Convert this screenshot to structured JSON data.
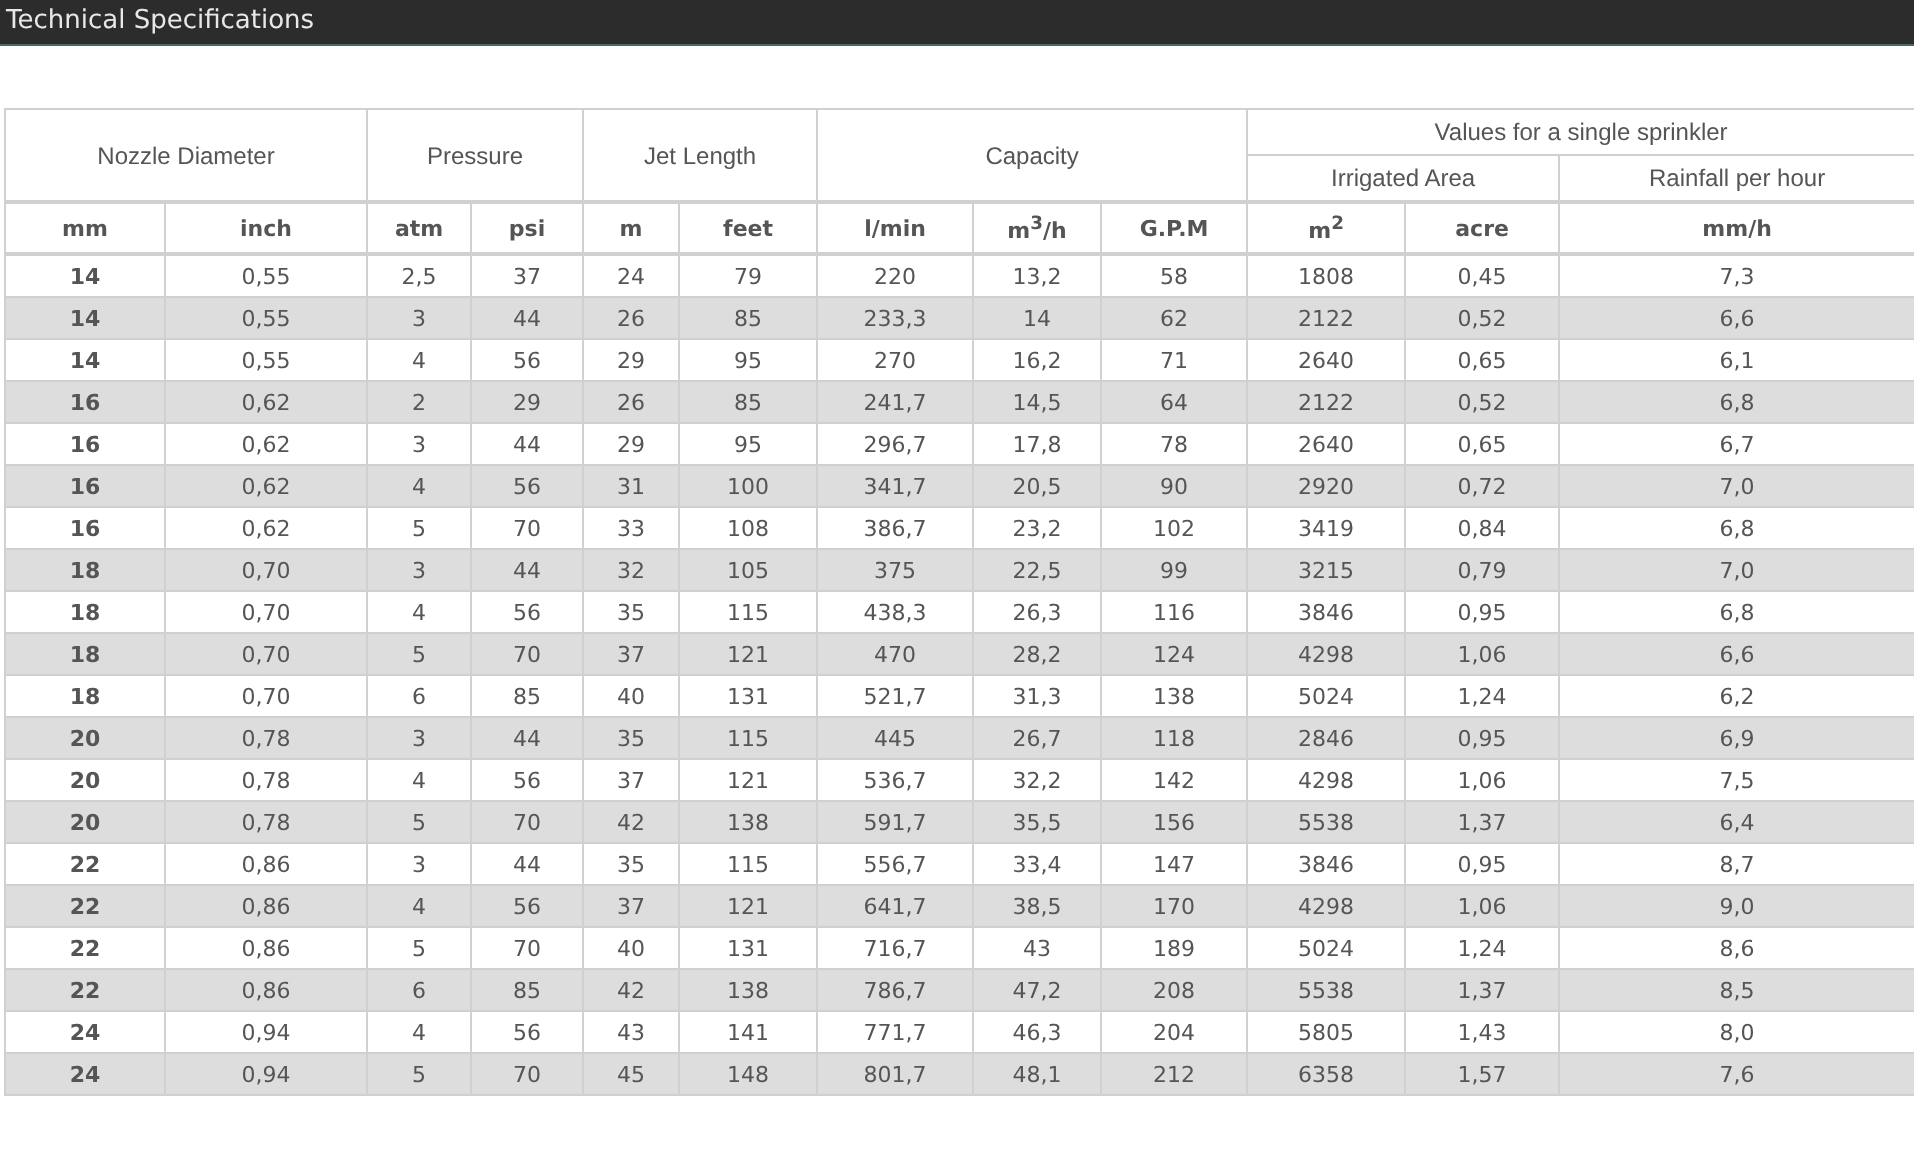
{
  "title": "Technical Specifications",
  "table": {
    "headers": {
      "nozzle_diameter": "Nozzle Diameter",
      "pressure": "Pressure",
      "jet_length": "Jet Length",
      "capacity": "Capacity",
      "single_sprinkler": "Values for a single sprinkler",
      "irrigated_area": "Irrigated Area",
      "rainfall_per_hour": "Rainfall per hour"
    },
    "units": [
      "mm",
      "inch",
      "atm",
      "psi",
      "m",
      "feet",
      "l/min",
      "m$^{3}$/h",
      "G.P.M",
      "m$^{2}$",
      "acre",
      "mm/h"
    ],
    "rows": [
      [
        "14",
        "0,55",
        "2,5",
        "37",
        "24",
        "79",
        "220",
        "13,2",
        "58",
        "1808",
        "0,45",
        "7,3"
      ],
      [
        "14",
        "0,55",
        "3",
        "44",
        "26",
        "85",
        "233,3",
        "14",
        "62",
        "2122",
        "0,52",
        "6,6"
      ],
      [
        "14",
        "0,55",
        "4",
        "56",
        "29",
        "95",
        "270",
        "16,2",
        "71",
        "2640",
        "0,65",
        "6,1"
      ],
      [
        "16",
        "0,62",
        "2",
        "29",
        "26",
        "85",
        "241,7",
        "14,5",
        "64",
        "2122",
        "0,52",
        "6,8"
      ],
      [
        "16",
        "0,62",
        "3",
        "44",
        "29",
        "95",
        "296,7",
        "17,8",
        "78",
        "2640",
        "0,65",
        "6,7"
      ],
      [
        "16",
        "0,62",
        "4",
        "56",
        "31",
        "100",
        "341,7",
        "20,5",
        "90",
        "2920",
        "0,72",
        "7,0"
      ],
      [
        "16",
        "0,62",
        "5",
        "70",
        "33",
        "108",
        "386,7",
        "23,2",
        "102",
        "3419",
        "0,84",
        "6,8"
      ],
      [
        "18",
        "0,70",
        "3",
        "44",
        "32",
        "105",
        "375",
        "22,5",
        "99",
        "3215",
        "0,79",
        "7,0"
      ],
      [
        "18",
        "0,70",
        "4",
        "56",
        "35",
        "115",
        "438,3",
        "26,3",
        "116",
        "3846",
        "0,95",
        "6,8"
      ],
      [
        "18",
        "0,70",
        "5",
        "70",
        "37",
        "121",
        "470",
        "28,2",
        "124",
        "4298",
        "1,06",
        "6,6"
      ],
      [
        "18",
        "0,70",
        "6",
        "85",
        "40",
        "131",
        "521,7",
        "31,3",
        "138",
        "5024",
        "1,24",
        "6,2"
      ],
      [
        "20",
        "0,78",
        "3",
        "44",
        "35",
        "115",
        "445",
        "26,7",
        "118",
        "2846",
        "0,95",
        "6,9"
      ],
      [
        "20",
        "0,78",
        "4",
        "56",
        "37",
        "121",
        "536,7",
        "32,2",
        "142",
        "4298",
        "1,06",
        "7,5"
      ],
      [
        "20",
        "0,78",
        "5",
        "70",
        "42",
        "138",
        "591,7",
        "35,5",
        "156",
        "5538",
        "1,37",
        "6,4"
      ],
      [
        "22",
        "0,86",
        "3",
        "44",
        "35",
        "115",
        "556,7",
        "33,4",
        "147",
        "3846",
        "0,95",
        "8,7"
      ],
      [
        "22",
        "0,86",
        "4",
        "56",
        "37",
        "121",
        "641,7",
        "38,5",
        "170",
        "4298",
        "1,06",
        "9,0"
      ],
      [
        "22",
        "0,86",
        "5",
        "70",
        "40",
        "131",
        "716,7",
        "43",
        "189",
        "5024",
        "1,24",
        "8,6"
      ],
      [
        "22",
        "0,86",
        "6",
        "85",
        "42",
        "138",
        "786,7",
        "47,2",
        "208",
        "5538",
        "1,37",
        "8,5"
      ],
      [
        "24",
        "0,94",
        "4",
        "56",
        "43",
        "141",
        "771,7",
        "46,3",
        "204",
        "5805",
        "1,43",
        "8,0"
      ],
      [
        "24",
        "0,94",
        "5",
        "70",
        "45",
        "148",
        "801,7",
        "48,1",
        "212",
        "6358",
        "1,57",
        "7,6"
      ]
    ]
  }
}
